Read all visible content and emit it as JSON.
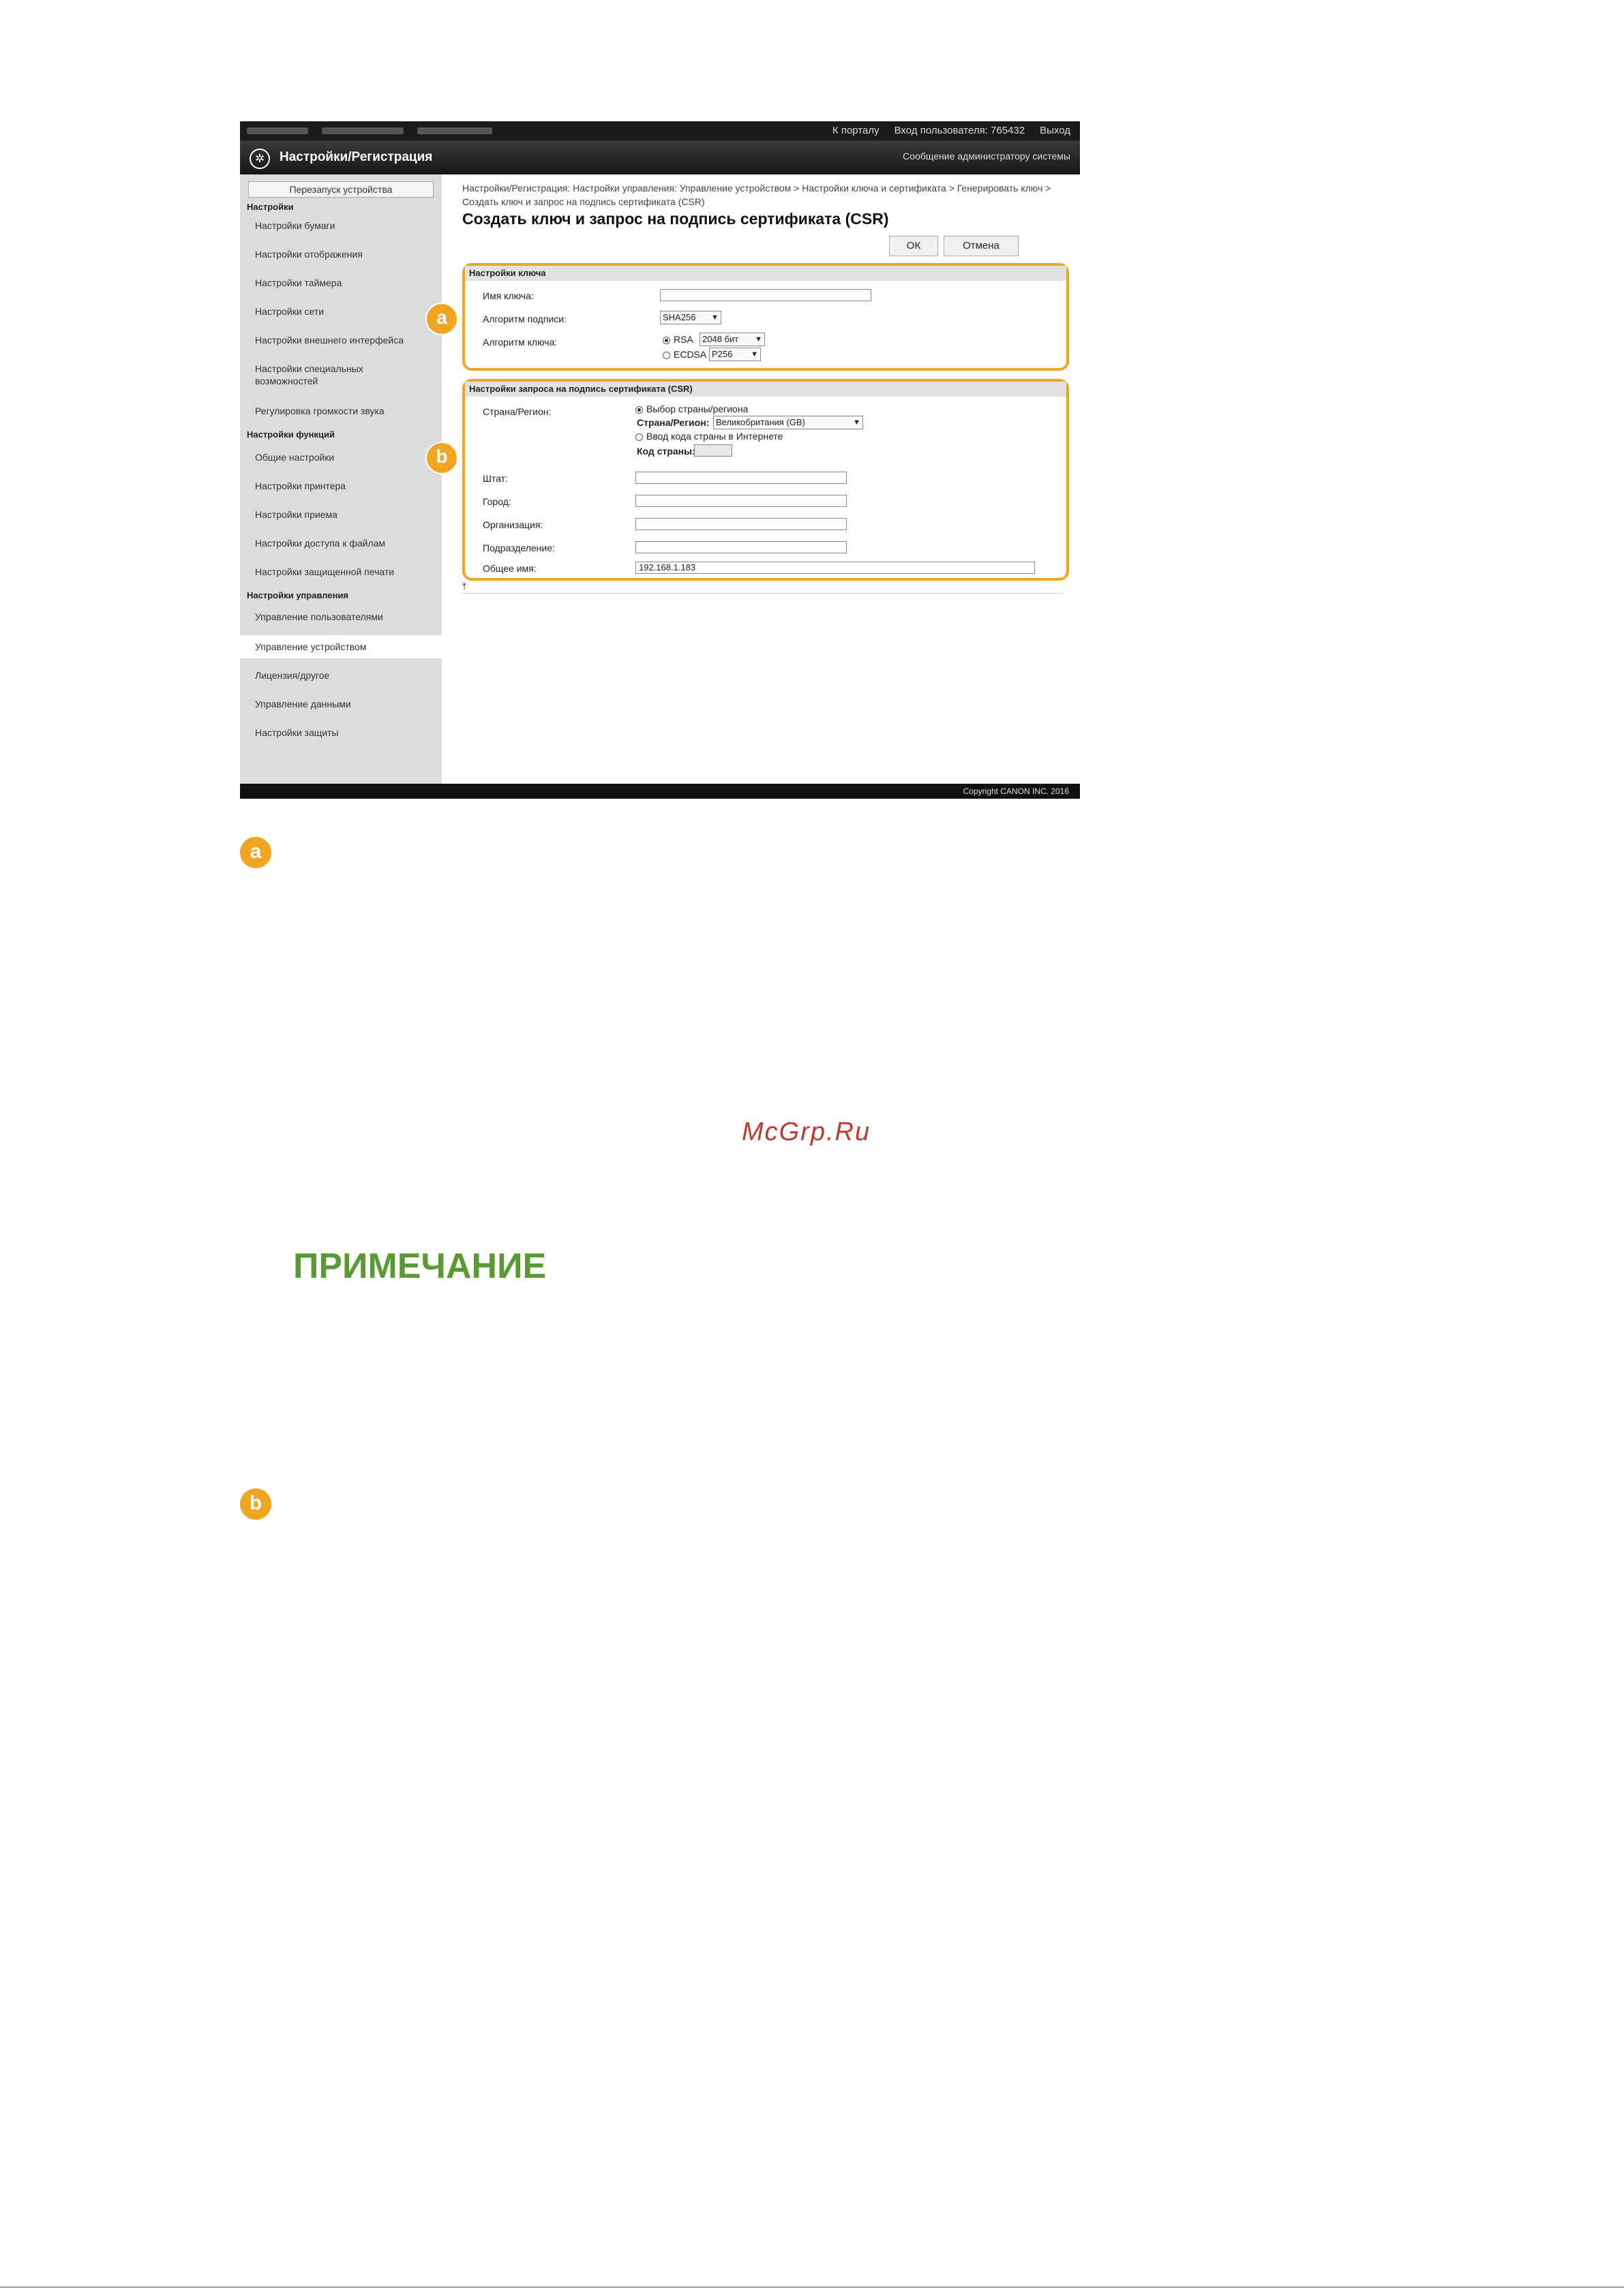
{
  "topbar": {
    "portal_link": "К порталу",
    "login_label": "Вход пользователя:",
    "user_id": "765432",
    "logout": "Выход"
  },
  "header": {
    "title": "Настройки/Регистрация",
    "admin_message": "Сообщение администратору системы"
  },
  "sidebar": {
    "reboot_button": "Перезапуск устройства",
    "sections": [
      {
        "title": "Настройки",
        "items": [
          "Настройки бумаги",
          "Настройки отображения",
          "Настройки таймера",
          "Настройки сети",
          "Настройки внешнего интерфейса",
          "Настройки специальных возможностей",
          "Регулировка громкости звука"
        ]
      },
      {
        "title": "Настройки функций",
        "items": [
          "Общие настройки",
          "Настройки принтера",
          "Настройки приема",
          "Настройки доступа к файлам",
          "Настройки защищенной печати"
        ]
      },
      {
        "title": "Настройки управления",
        "items": [
          "Управление пользователями",
          "Управление устройством",
          "Лицензия/другое",
          "Управление данными",
          "Настройки защиты"
        ]
      }
    ],
    "active_item": "Управление устройством"
  },
  "content": {
    "breadcrumb": "Настройки/Регистрация: Настройки управления: Управление устройством > Настройки ключа и сертификата > Генерировать ключ > Создать ключ и запрос на подпись сертификата (CSR)",
    "page_title": "Создать ключ и запрос на подпись сертификата (CSR)",
    "ok_button": "ОК",
    "cancel_button": "Отмена",
    "key_settings": {
      "heading": "Настройки ключа",
      "key_name_label": "Имя ключа:",
      "key_name_value": "",
      "sig_alg_label": "Алгоритм подписи:",
      "sig_alg_value": "SHA256",
      "key_alg_label": "Алгоритм ключа:",
      "rsa_label": "RSA",
      "rsa_length": "2048 бит",
      "ecdsa_label": "ECDSA",
      "ecdsa_curve": "P256"
    },
    "csr_settings": {
      "heading": "Настройки запроса на подпись сертификата (CSR)",
      "country_label": "Страна/Регион:",
      "select_country_option": "Выбор страны/региона",
      "country_sub_label": "Страна/Регион:",
      "country_value": "Великобритания (GB)",
      "internet_code_option": "Ввод кода страны в Интернете",
      "country_code_label": "Код страны:",
      "state_label": "Штат:",
      "city_label": "Город:",
      "org_label": "Организация:",
      "unit_label": "Подразделение:",
      "common_name_label": "Общее имя:",
      "common_name_value": "192.168.1.183"
    },
    "callout_a": "a",
    "callout_b": "b"
  },
  "footer": {
    "copyright": "Copyright CANON INC. 2016"
  },
  "page": {
    "badge_a": "a",
    "badge_b": "b",
    "watermark": "McGrp.Ru",
    "note_heading": "ПРИМЕЧАНИЕ"
  },
  "colors": {
    "accent_orange": "#f0a521",
    "note_green": "#5a9a32",
    "watermark_red": "#c0392b"
  }
}
